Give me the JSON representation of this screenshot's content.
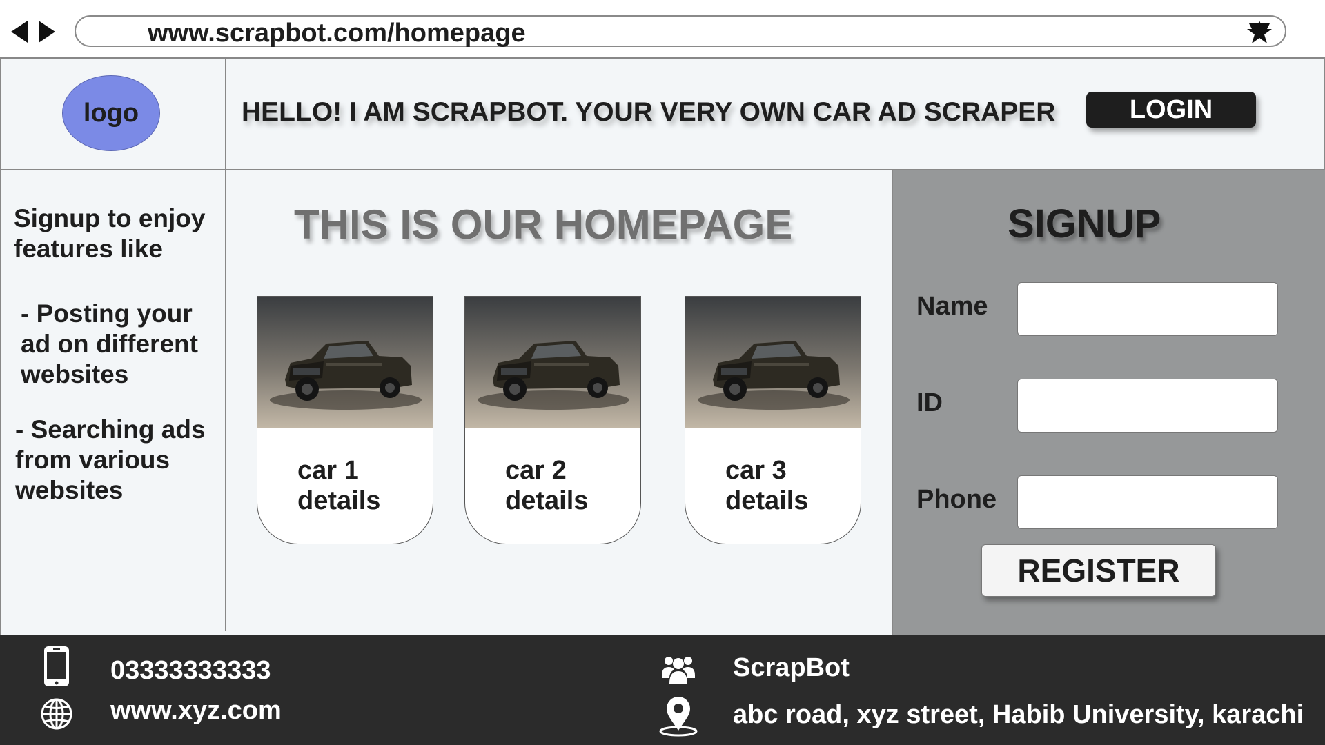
{
  "browser": {
    "url": "www.scrapbot.com/homepage",
    "back_icon": "arrow-left-icon",
    "forward_icon": "arrow-right-icon",
    "bookmark_icon": "star-icon"
  },
  "header": {
    "logo_label": "logo",
    "welcome": "HELLO! I AM SCRAPBOT. YOUR VERY OWN CAR AD SCRAPER",
    "login_label": "LOGIN"
  },
  "sidebar": {
    "intro_line1": "Signup to enjoy",
    "intro_line2": "features like",
    "feature1_line1": "- Posting your",
    "feature1_line2": "ad on different",
    "feature1_line3": "websites",
    "feature2_line1": "- Searching ads",
    "feature2_line2": "from various",
    "feature2_line3": "websites"
  },
  "main": {
    "title": "THIS IS OUR HOMEPAGE",
    "cards": [
      {
        "line1": "car 1",
        "line2": "details"
      },
      {
        "line1": "car 2",
        "line2": "details"
      },
      {
        "line1": "car 3",
        "line2": "details"
      }
    ]
  },
  "signup": {
    "title": "SIGNUP",
    "name_label": "Name",
    "id_label": "ID",
    "phone_label": "Phone",
    "name_value": "",
    "id_value": "",
    "phone_value": "",
    "register_label": "REGISTER"
  },
  "footer": {
    "phone": "03333333333",
    "website": "www.xyz.com",
    "brand": "ScrapBot",
    "address": "abc road, xyz street, Habib University, karachi"
  },
  "colors": {
    "logo": "#7b8ae6",
    "signup_panel": "#969899",
    "footer": "#2b2b2b",
    "login_button": "#1e1e1e"
  }
}
